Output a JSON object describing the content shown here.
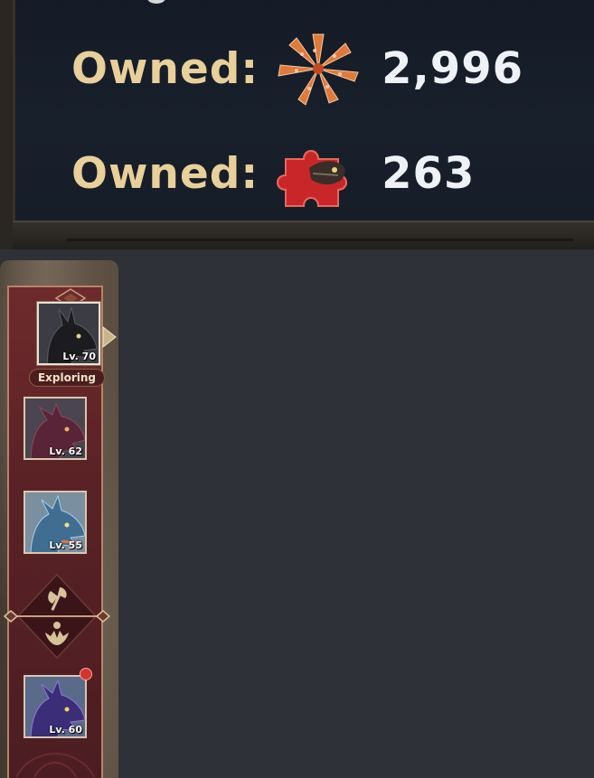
{
  "owned_panel": {
    "rows": [
      {
        "label": "Owned:",
        "icon": "leaf-petal-icon",
        "value": "2,996"
      },
      {
        "label": "Owned:",
        "icon": "puzzle-piece-icon",
        "value": "263"
      }
    ]
  },
  "sidebar": {
    "dragons": [
      {
        "level": "Lv. 70",
        "status": "Exploring",
        "color": "#2a2a2e"
      },
      {
        "level": "Lv. 62",
        "color": "#5a2a3a"
      },
      {
        "level": "Lv. 55",
        "color": "#4d7fa0"
      },
      {
        "level": "Lv. 60",
        "color": "#3a2f6a"
      }
    ],
    "skill_icons": [
      "axe-icon",
      "hand-orb-icon"
    ]
  },
  "colors": {
    "label_gold": "#e9cf9a",
    "panel_red": "#5a2226",
    "notification_red": "#d8322e"
  }
}
